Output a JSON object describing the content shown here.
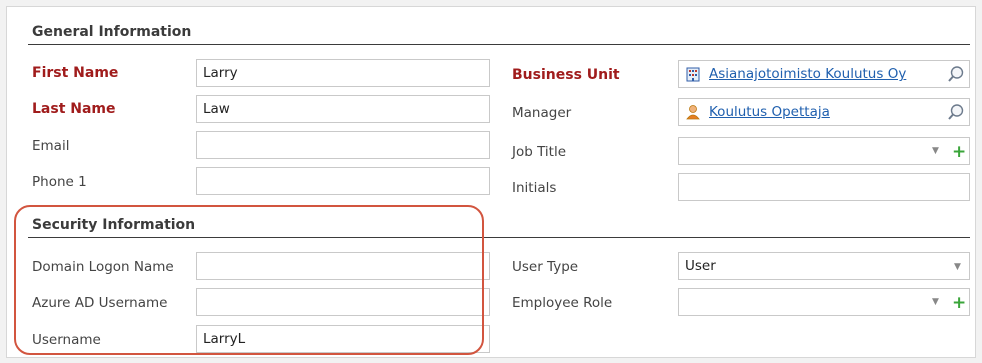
{
  "general": {
    "title": "General Information",
    "first_name_label": "First Name",
    "first_name_value": "Larry",
    "last_name_label": "Last Name",
    "last_name_value": "Law",
    "email_label": "Email",
    "email_value": "",
    "phone_label": "Phone 1",
    "phone_value": "",
    "business_unit_label": "Business Unit",
    "business_unit_value": "Asianajotoimisto Koulutus Oy",
    "manager_label": "Manager",
    "manager_value": "Koulutus Opettaja",
    "job_title_label": "Job Title",
    "job_title_value": "",
    "initials_label": "Initials",
    "initials_value": ""
  },
  "security": {
    "title": "Security Information",
    "domain_logon_label": "Domain Logon Name",
    "domain_logon_value": "",
    "azure_label": "Azure AD Username",
    "azure_value": "",
    "username_label": "Username",
    "username_value": "LarryL",
    "user_type_label": "User Type",
    "user_type_value": "User",
    "employee_role_label": "Employee Role",
    "employee_role_value": ""
  },
  "icons": {
    "business_unit": "building-icon",
    "manager": "person-icon",
    "lookup": "magnifier-icon",
    "dropdown": "chevron-down-icon",
    "add": "plus-icon"
  },
  "colors": {
    "required_label": "#a01c1c",
    "link": "#1f5fae",
    "highlight": "#d2553f",
    "add": "#3aa53a"
  }
}
